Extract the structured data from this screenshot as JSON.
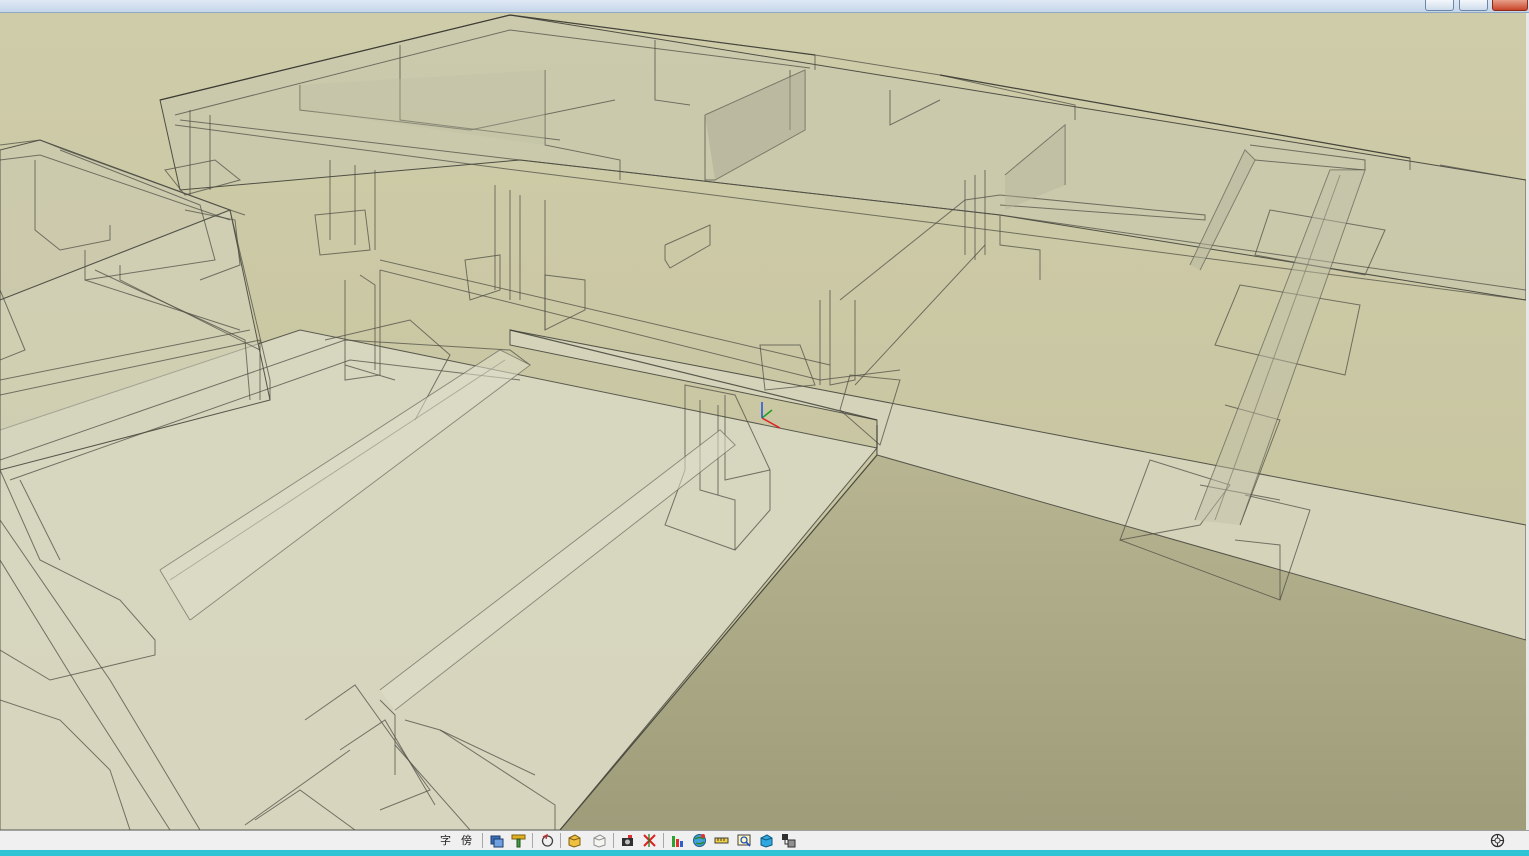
{
  "window": {
    "controls": [
      "minimize-button",
      "maximize-button",
      "close-button"
    ]
  },
  "viewport": {
    "colors": {
      "sky": "#cac7a3",
      "ground": "#aeac89",
      "slab": "#dcdcc8",
      "edge": "#55554a"
    },
    "axis_colors": {
      "x": "#e02020",
      "y": "#20a020",
      "z": "#2050e0"
    }
  },
  "statusbar": {
    "text_items": [
      {
        "name": "char-mode-label",
        "text": "字"
      },
      {
        "name": "side-mode-label",
        "text": "傍"
      }
    ],
    "tool_icons": [
      "layers-icon",
      "section-icon",
      "orbit-icon",
      "box-icon",
      "box-outline-icon",
      "camera-icon",
      "cross-icon",
      "chart-icon",
      "globe-icon",
      "ruler-icon",
      "zoom-window-icon",
      "cube-icon",
      "component-icon",
      "navigation-wheel-icon"
    ]
  }
}
